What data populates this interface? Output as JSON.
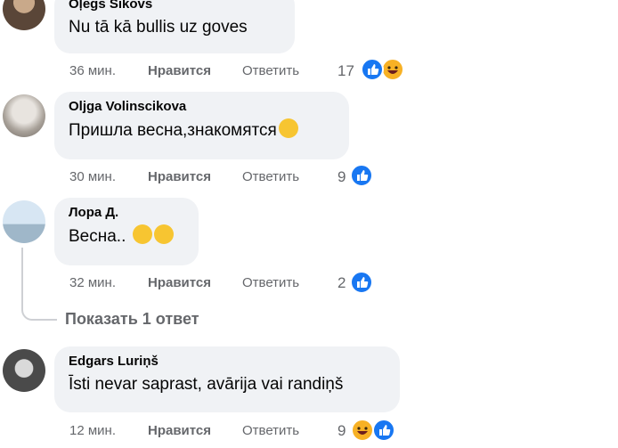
{
  "comments": [
    {
      "author": "Oļegs Sikovs",
      "text": "Nu tā kā bullis uz goves",
      "time": "36 мин.",
      "like_label": "Нравится",
      "reply_label": "Ответить",
      "reaction_count": "17",
      "reactions": [
        "like-icon",
        "haha-icon"
      ]
    },
    {
      "author": "Olјga Volinscikova",
      "text": "Пришла весна,знакомятся",
      "text_emoji": "rofl-emoji",
      "time": "30 мин.",
      "like_label": "Нравится",
      "reply_label": "Ответить",
      "reaction_count": "9",
      "reactions": [
        "like-icon"
      ]
    },
    {
      "author": "Лора Д.",
      "text": "Весна..",
      "text_emojis": [
        "relieved-emoji",
        "grin-emoji"
      ],
      "time": "32 мин.",
      "like_label": "Нравится",
      "reply_label": "Ответить",
      "reaction_count": "2",
      "reactions": [
        "like-icon"
      ],
      "show_replies_label": "Показать 1 ответ"
    },
    {
      "author": "Edgars Luriņš",
      "text": "Īsti nevar saprast, avārija vai randiņš",
      "time": "12 мин.",
      "like_label": "Нравится",
      "reply_label": "Ответить",
      "reaction_count": "9",
      "reactions": [
        "haha-icon",
        "like-icon"
      ]
    }
  ],
  "colors": {
    "bubble": "#f0f2f5",
    "meta_text": "#65676b",
    "like_blue": "#1877f2",
    "haha_yellow": "#f7b125"
  }
}
